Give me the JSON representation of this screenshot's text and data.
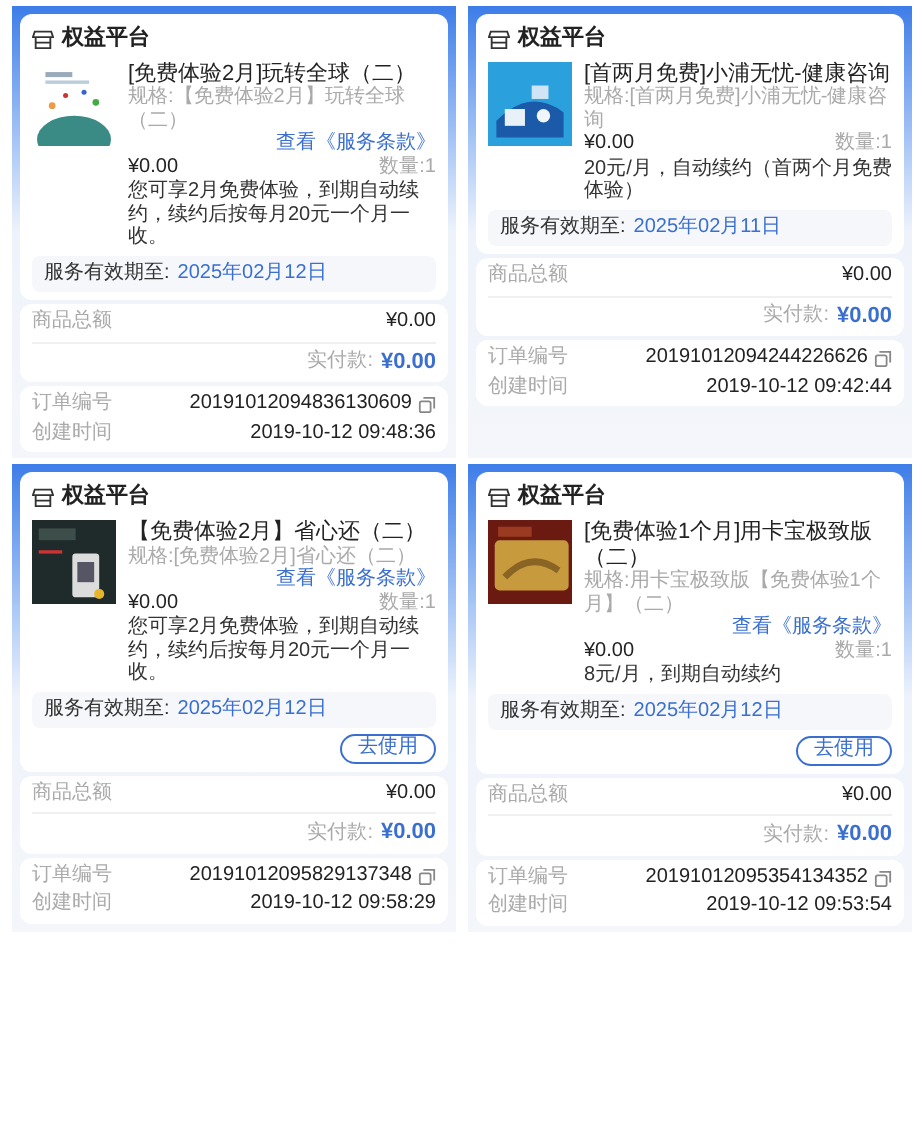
{
  "orders": [
    {
      "store": "权益平台",
      "title": "[免费体验2月]玩转全球（二）",
      "spec": "规格:【免费体验2月】玩转全球（二）",
      "terms": "查看《服务条款》",
      "price": "¥0.00",
      "qty": "数量:1",
      "desc": "您可享2月免费体验，到期自动续约，续约后按每月20元一个月一收。",
      "validity_label": "服务有效期至:",
      "validity": "2025年02月12日",
      "total_label": "商品总额",
      "total": "¥0.00",
      "paid_label": "实付款:",
      "paid": "¥0.00",
      "order_label": "订单编号",
      "order_no": "20191012094836130609",
      "created_label": "创建时间",
      "created": "2019-10-12 09:48:36"
    },
    {
      "store": "权益平台",
      "title": "[首两月免费]小浦无忧-健康咨询",
      "spec": "规格:[首两月免费]小浦无忧-健康咨询",
      "price": "¥0.00",
      "qty": "数量:1",
      "desc": "20元/月，自动续约（首两个月免费体验）",
      "validity_label": "服务有效期至:",
      "validity": "2025年02月11日",
      "total_label": "商品总额",
      "total": "¥0.00",
      "paid_label": "实付款:",
      "paid": "¥0.00",
      "order_label": "订单编号",
      "order_no": "20191012094244226626",
      "created_label": "创建时间",
      "created": "2019-10-12 09:42:44"
    },
    {
      "store": "权益平台",
      "title": "【免费体验2月】省心还（二）",
      "spec": "规格:[免费体验2月]省心还（二）",
      "terms": "查看《服务条款》",
      "price": "¥0.00",
      "qty": "数量:1",
      "desc": "您可享2月免费体验，到期自动续约，续约后按每月20元一个月一收。",
      "validity_label": "服务有效期至:",
      "validity": "2025年02月12日",
      "button": "去使用",
      "total_label": "商品总额",
      "total": "¥0.00",
      "paid_label": "实付款:",
      "paid": "¥0.00",
      "order_label": "订单编号",
      "order_no": "20191012095829137348",
      "created_label": "创建时间",
      "created": "2019-10-12 09:58:29"
    },
    {
      "store": "权益平台",
      "title": "[免费体验1个月]用卡宝极致版（二）",
      "spec": "规格:用卡宝极致版【免费体验1个月】（二）",
      "terms": "查看《服务条款》",
      "price": "¥0.00",
      "qty": "数量:1",
      "desc": "8元/月，到期自动续约",
      "validity_label": "服务有效期至:",
      "validity": "2025年02月12日",
      "button": "去使用",
      "total_label": "商品总额",
      "total": "¥0.00",
      "paid_label": "实付款:",
      "paid": "¥0.00",
      "order_label": "订单编号",
      "order_no": "20191012095354134352",
      "created_label": "创建时间",
      "created": "2019-10-12 09:53:54"
    }
  ]
}
